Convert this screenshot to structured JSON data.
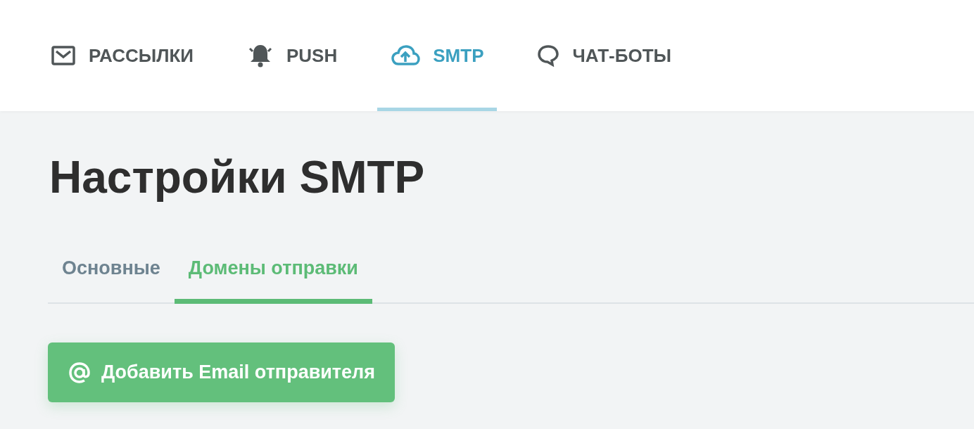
{
  "nav_tabs": [
    {
      "label": "РАССЫЛКИ",
      "selected": false
    },
    {
      "label": "PUSH",
      "selected": false
    },
    {
      "label": "SMTP",
      "selected": true
    },
    {
      "label": "ЧАТ-БОТЫ",
      "selected": false
    }
  ],
  "page_title": "Настройки SMTP",
  "sub_tabs": [
    {
      "label": "Основные",
      "selected": false
    },
    {
      "label": "Домены отправки",
      "selected": true
    }
  ],
  "add_button": {
    "label": "Добавить Email отправителя"
  }
}
